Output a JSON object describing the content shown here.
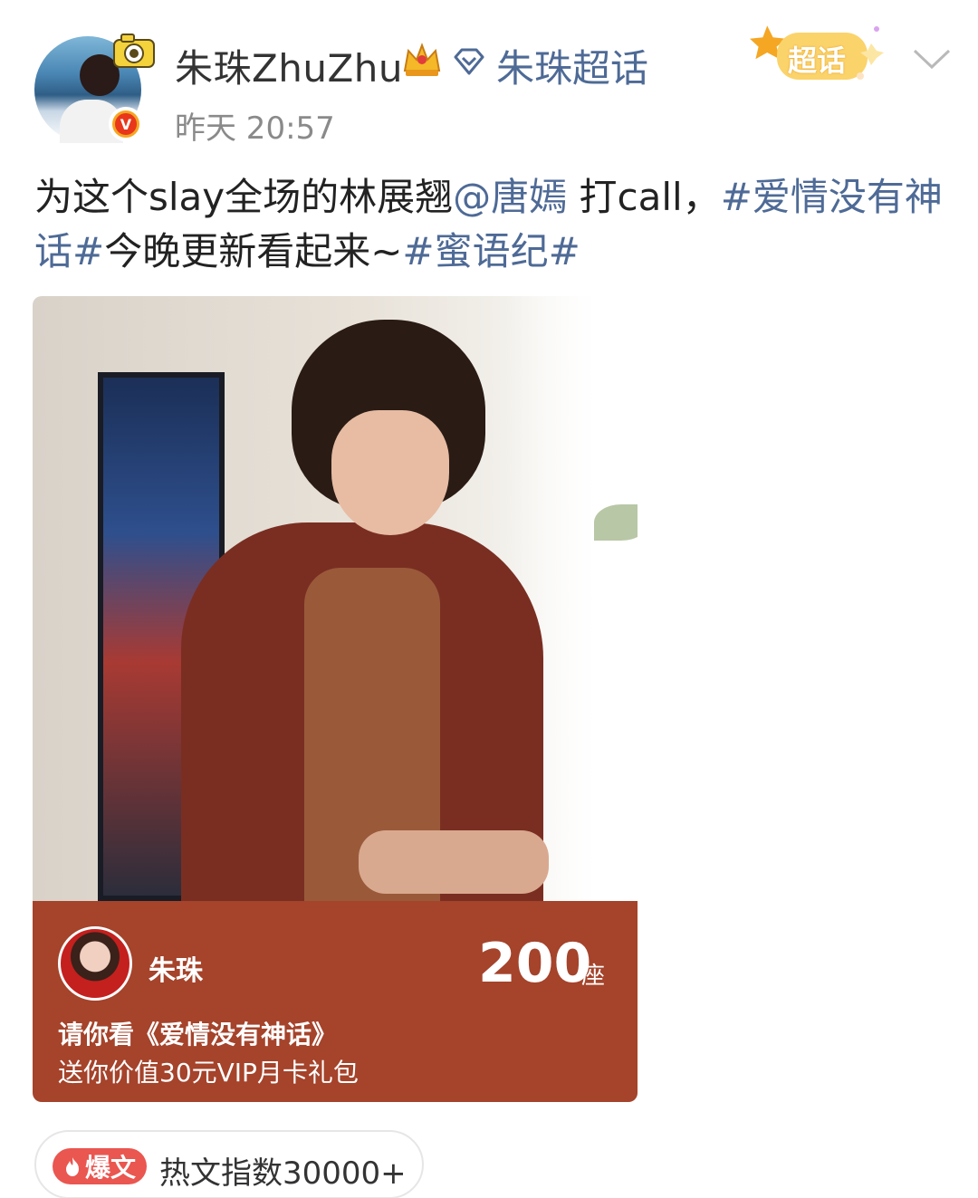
{
  "header": {
    "username": "朱珠ZhuZhu",
    "super_topic": "朱珠超话",
    "time": "昨天 20:57",
    "badge": "超话",
    "verified_badge": "V"
  },
  "post": {
    "text_prefix": "为这个slay全场的林展翘",
    "mention": "@唐嫣",
    "text_middle": " 打call，",
    "tag1": "#爱情没有神话#",
    "text_mid2": "今晚更新看起来~",
    "tag2": "#蜜语纪#"
  },
  "card": {
    "name": "朱珠",
    "seat_count": "200",
    "seat_unit": "座",
    "title": "请你看《爱情没有神话》",
    "subtitle": "送你价值30元VIP月卡礼包"
  },
  "hot": {
    "tag": "爆文",
    "text": "热文指数30000+"
  },
  "icons": {
    "crown": "crown-icon",
    "diamond": "diamond-icon",
    "chevron": "chevron-down-icon",
    "fire": "fire-icon"
  },
  "colors": {
    "link": "#4e6a96",
    "card_bg": "#a5432b",
    "hot_tag": "#ea5650"
  }
}
